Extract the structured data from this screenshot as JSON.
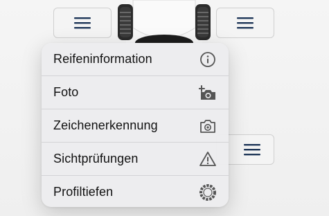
{
  "menu": {
    "items": [
      {
        "label": "Reifeninformation",
        "icon": "info-circle-icon"
      },
      {
        "label": "Foto",
        "icon": "add-photo-icon"
      },
      {
        "label": "Zeichenerkennung",
        "icon": "camera-scan-icon"
      },
      {
        "label": "Sichtprüfungen",
        "icon": "warning-triangle-icon"
      },
      {
        "label": "Profiltiefen",
        "icon": "tire-ring-icon"
      }
    ]
  },
  "colors": {
    "menu_icon": "#1d3557",
    "text": "#111111",
    "icon": "#555555"
  }
}
